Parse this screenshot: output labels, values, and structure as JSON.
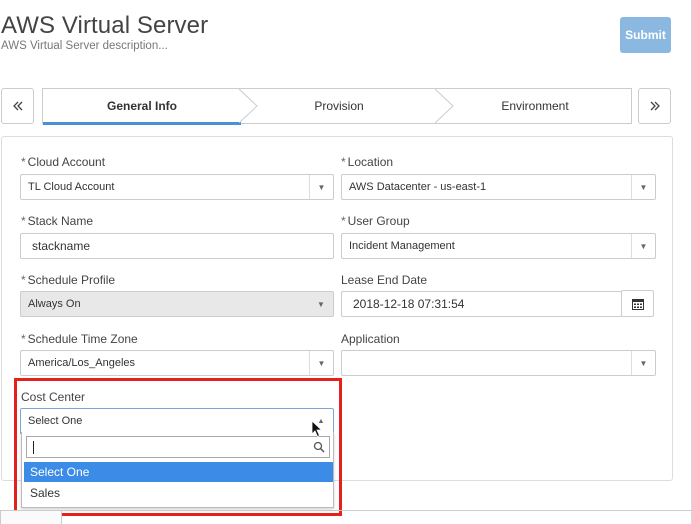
{
  "header": {
    "title": "AWS Virtual Server",
    "description": "AWS Virtual Server description...",
    "submit_label": "Submit"
  },
  "wizard": {
    "prev_icon": "double-chevron-left-icon",
    "next_icon": "double-chevron-right-icon",
    "steps": [
      {
        "label": "General Info",
        "active": true
      },
      {
        "label": "Provision",
        "active": false
      },
      {
        "label": "Environment",
        "active": false
      }
    ]
  },
  "form": {
    "cloud_account": {
      "label": "Cloud Account",
      "required": "*",
      "value": "TL Cloud Account"
    },
    "location": {
      "label": "Location",
      "required": "*",
      "value": "AWS Datacenter - us-east-1"
    },
    "stack_name": {
      "label": "Stack Name",
      "required": "*",
      "value": "stackname"
    },
    "user_group": {
      "label": "User Group",
      "required": "*",
      "value": "Incident Management"
    },
    "schedule_profile": {
      "label": "Schedule Profile",
      "required": "*",
      "value": "Always On",
      "disabled": true
    },
    "lease_end_date": {
      "label": "Lease End Date",
      "value": "2018-12-18 07:31:54"
    },
    "schedule_time_zone": {
      "label": "Schedule Time Zone",
      "required": "*",
      "value": "America/Los_Angeles"
    },
    "application": {
      "label": "Application",
      "value": ""
    },
    "cost_center": {
      "label": "Cost Center",
      "value": "Select One",
      "search_value": "",
      "options": [
        {
          "label": "Select One",
          "selected": true
        },
        {
          "label": "Sales",
          "selected": false
        }
      ]
    }
  },
  "colors": {
    "accent": "#4a90d9",
    "submit_bg": "#8bb8e0",
    "selected_option": "#3c8ce7",
    "highlight_box": "#e3221b"
  }
}
